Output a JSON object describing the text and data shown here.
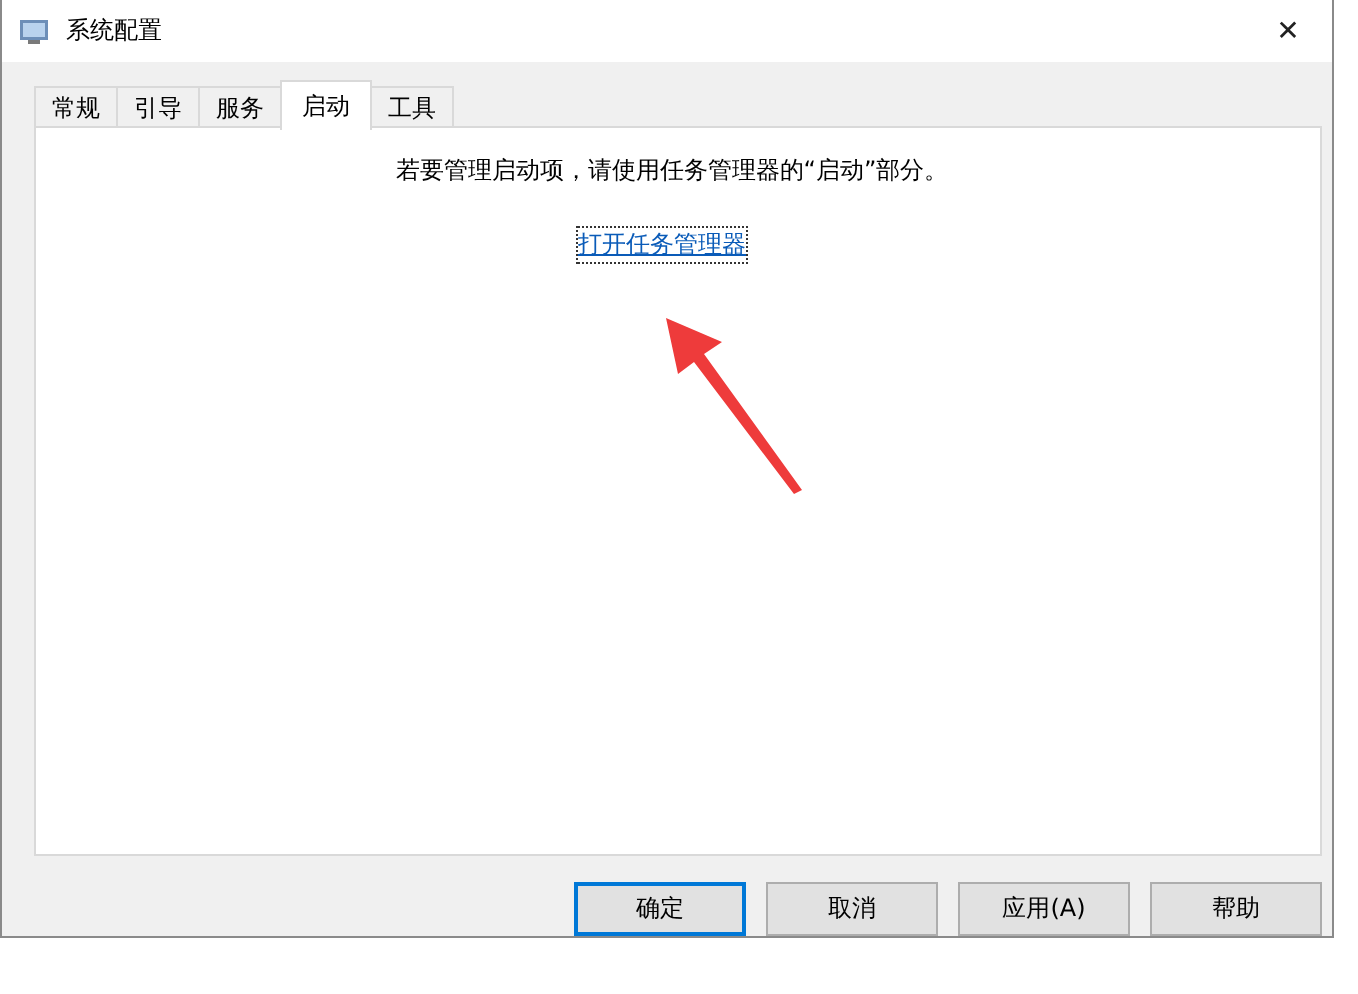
{
  "window": {
    "title": "系统配置",
    "close": "✕"
  },
  "tabs": [
    {
      "label": "常规",
      "selected": false
    },
    {
      "label": "引导",
      "selected": false
    },
    {
      "label": "服务",
      "selected": false
    },
    {
      "label": "启动",
      "selected": true
    },
    {
      "label": "工具",
      "selected": false
    }
  ],
  "panel": {
    "message": "若要管理启动项，请使用任务管理器的“启动”部分。",
    "link": "打开任务管理器"
  },
  "buttons": [
    {
      "label": "确定",
      "default": true
    },
    {
      "label": "取消",
      "default": false
    },
    {
      "label": "应用(A)",
      "default": false
    },
    {
      "label": "帮助",
      "default": false
    }
  ]
}
